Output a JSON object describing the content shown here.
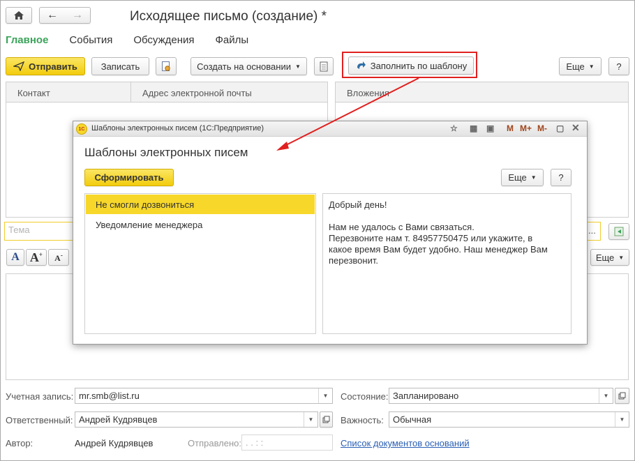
{
  "window": {
    "title": "Исходящее письмо  (создание) *"
  },
  "tabs": [
    "Главное",
    "События",
    "Обсуждения",
    "Файлы"
  ],
  "toolbar": {
    "send_label": "Отправить",
    "write_label": "Записать",
    "create_based_label": "Создать на основании",
    "fill_template_label": "Заполнить по шаблону",
    "more_label": "Еще",
    "help_label": "?"
  },
  "recipients": {
    "col_contact": "Контакт",
    "col_email": "Адрес электронной почты",
    "col_attachments": "Вложения"
  },
  "subject": {
    "placeholder": "Тема",
    "ellipsis": "..."
  },
  "editor": {
    "more_label": "Еще"
  },
  "modal": {
    "window_title": "Шаблоны электронных писем  (1С:Предприятие)",
    "heading": "Шаблоны электронных писем",
    "generate_label": "Сформировать",
    "more_label": "Еще",
    "help_label": "?",
    "controls": [
      "M",
      "M+",
      "M-"
    ],
    "templates": [
      "Не смогли дозвониться",
      "Уведомление менеджера"
    ],
    "preview_text": "Добрый день!\n\nНам не удалось с Вами связаться.\nПерезвоните нам т. 84957750475 или укажите, в\nкакое время Вам будет удобно. Наш менеджер Вам\nперезвонит."
  },
  "footer": {
    "account_label": "Учетная запись:",
    "account_value": "mr.smb@list.ru",
    "responsible_label": "Ответственный:",
    "responsible_value": "Андрей Кудрявцев",
    "author_label": "Автор:",
    "author_value": "Андрей Кудрявцев",
    "sent_label": "Отправлено:",
    "sent_value": " .  .      :  :",
    "state_label": "Состояние:",
    "state_value": "Запланировано",
    "importance_label": "Важность:",
    "importance_value": "Обычная",
    "basis_docs_link": "Список документов оснований"
  },
  "colors": {
    "accent_green": "#3aa35a",
    "button_yellow": "#f2cc0c",
    "highlight_red": "#e0201f",
    "link_blue": "#2a5fb5"
  }
}
